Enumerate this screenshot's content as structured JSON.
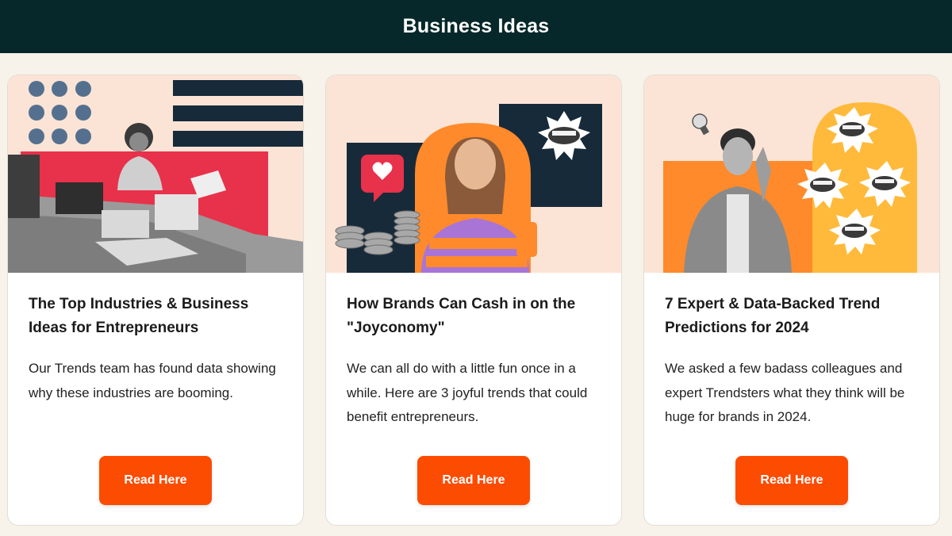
{
  "header": {
    "title": "Business Ideas"
  },
  "colors": {
    "header_bg": "#06282a",
    "page_bg": "#f7f2ea",
    "button_bg": "#fc4c02",
    "accent_red": "#e8314a",
    "accent_orange": "#ff8a2b",
    "navy": "#172a3a"
  },
  "cards": [
    {
      "title": "The Top Industries & Business Ideas for Entrepreneurs",
      "description": "Our Trends team has found data showing why these industries are booming.",
      "button_label": "Read Here"
    },
    {
      "title": "How Brands Can Cash in on the \"Joyconomy\"",
      "description": "We can all do with a little fun once in a while. Here are 3 joyful trends that could benefit entrepreneurs.",
      "button_label": "Read Here"
    },
    {
      "title": "7 Expert & Data-Backed Trend Predictions for 2024",
      "description": "We asked a few badass colleagues and expert Trendsters what they think will be huge for brands in 2024.",
      "button_label": "Read Here"
    }
  ]
}
